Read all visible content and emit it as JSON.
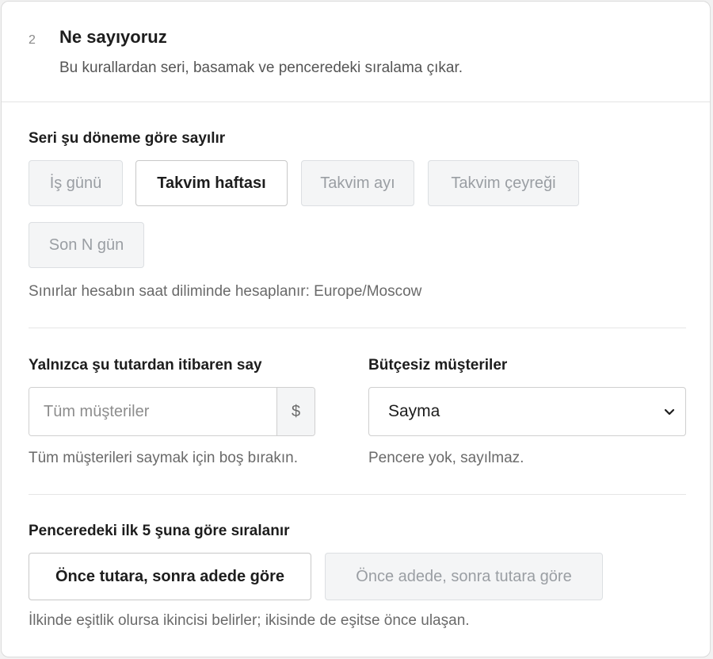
{
  "step": {
    "number": "2",
    "title": "Ne sayıyoruz",
    "subtitle": "Bu kurallardan seri, basamak ve penceredeki sıralama çıkar."
  },
  "period": {
    "label": "Seri şu döneme göre sayılır",
    "options": [
      "İş günü",
      "Takvim haftası",
      "Takvim ayı",
      "Takvim çeyreği",
      "Son N gün"
    ],
    "selected": "Takvim haftası",
    "hint": "Sınırlar hesabın saat diliminde hesaplanır: Europe/Moscow"
  },
  "threshold": {
    "label": "Yalnızca şu tutardan itibaren say",
    "value": "",
    "placeholder": "Tüm müşteriler",
    "currency": "$",
    "hint": "Tüm müşterileri saymak için boş bırakın."
  },
  "no_budget": {
    "label": "Bütçesiz müşteriler",
    "selected": "Sayma",
    "hint": "Pencere yok, sayılmaz."
  },
  "ranking": {
    "label": "Penceredeki ilk 5 şuna göre sıralanır",
    "options": [
      "Önce tutara, sonra adede göre",
      "Önce adede, sonra tutara göre"
    ],
    "selected": "Önce tutara, sonra adede göre",
    "hint": "İlkinde eşitlik olursa ikincisi belirler; ikisinde de eşitse önce ulaşan."
  },
  "icons": {
    "select_chevron": "chevron-down-icon"
  }
}
